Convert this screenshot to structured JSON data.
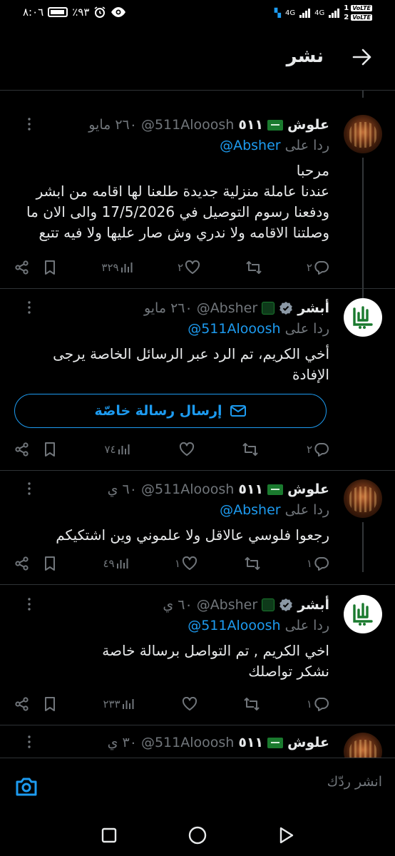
{
  "status_bar": {
    "time": "٨:٠٦",
    "battery": "٪٩٣",
    "sim1_label": "1",
    "sim2_label": "2",
    "sim1_net": "4G",
    "sim2_net": "4G",
    "volte": "VoLTE"
  },
  "header": {
    "title": "نشر"
  },
  "tweets": [
    {
      "name": "علوش",
      "name_suffix": "٥١١",
      "handle": "@511Alooosh",
      "date": "٢٦٠ مايو",
      "reply_prefix": "ردا على",
      "reply_to": "@Absher",
      "text": "مرحبا\nعندنا عاملة منزلية جديدة طلعنا لها اقامه من ابشر\nودفعنا رسوم التوصيل في 17/5/2026 والى الان ما\nوصلتنا الاقامه ولا ندري وش صار عليها ولا فيه تتبع",
      "replies": "٢",
      "retweets": "",
      "likes": "٢",
      "views": "٣٢٩"
    },
    {
      "name": "أبشر",
      "handle": "@Absher",
      "date": "٢٦٠ مايو",
      "reply_prefix": "ردا على",
      "reply_to": "@511Alooosh",
      "text": "أخي الكريم، تم الرد عبر الرسائل الخاصة يرجى\nالإفادة",
      "dm_button": "إرسال رسالة خاصّة",
      "replies": "٢",
      "retweets": "",
      "likes": "",
      "views": "٧٤"
    },
    {
      "name": "علوش",
      "name_suffix": "٥١١",
      "handle": "@511Alooosh",
      "date": "٦٠ ي",
      "reply_prefix": "ردا على",
      "reply_to": "@Absher",
      "text": "رجعوا فلوسي عالاقل ولا علموني وين اشتكيكم",
      "replies": "١",
      "retweets": "",
      "likes": "١",
      "views": "٤٩"
    },
    {
      "name": "أبشر",
      "handle": "@Absher",
      "date": "٦٠ ي",
      "reply_prefix": "ردا على",
      "reply_to": "@511Alooosh",
      "text": "اخي الكريم , تم التواصل برسالة خاصة\nنشكر تواصلك",
      "replies": "١",
      "retweets": "",
      "likes": "",
      "views": "٢٣٣"
    },
    {
      "name": "علوش",
      "name_suffix": "٥١١",
      "handle": "@511Alooosh",
      "date": "٣٠ ي"
    }
  ],
  "composer": {
    "placeholder": "انشر ردّك"
  },
  "colors": {
    "accent": "#1d9bf0",
    "muted": "#71767b",
    "text": "#e7e9ea",
    "background": "#000000",
    "brand_green": "#1a7a2e"
  }
}
